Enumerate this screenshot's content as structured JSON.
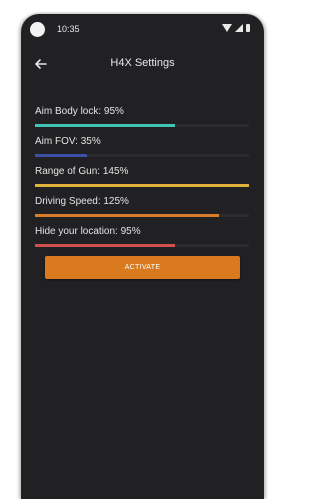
{
  "status_bar": {
    "time": "10:35"
  },
  "app_bar": {
    "title": "H4X Settings"
  },
  "settings": [
    {
      "label": "Aim Body lock: 95%",
      "value": 95,
      "max": 145,
      "color": "#41c4b4"
    },
    {
      "label": "Aim FOV: 35%",
      "value": 35,
      "max": 145,
      "color": "#3d50a8"
    },
    {
      "label": "Range of Gun: 145%",
      "value": 145,
      "max": 145,
      "color": "#e0b23c"
    },
    {
      "label": "Driving Speed: 125%",
      "value": 125,
      "max": 145,
      "color": "#d97d2a"
    },
    {
      "label": "Hide your location: 95%",
      "value": 95,
      "max": 145,
      "color": "#d24f4f"
    }
  ],
  "activate_button": {
    "label": "ACTIVATE",
    "color": "#d97a1f"
  }
}
